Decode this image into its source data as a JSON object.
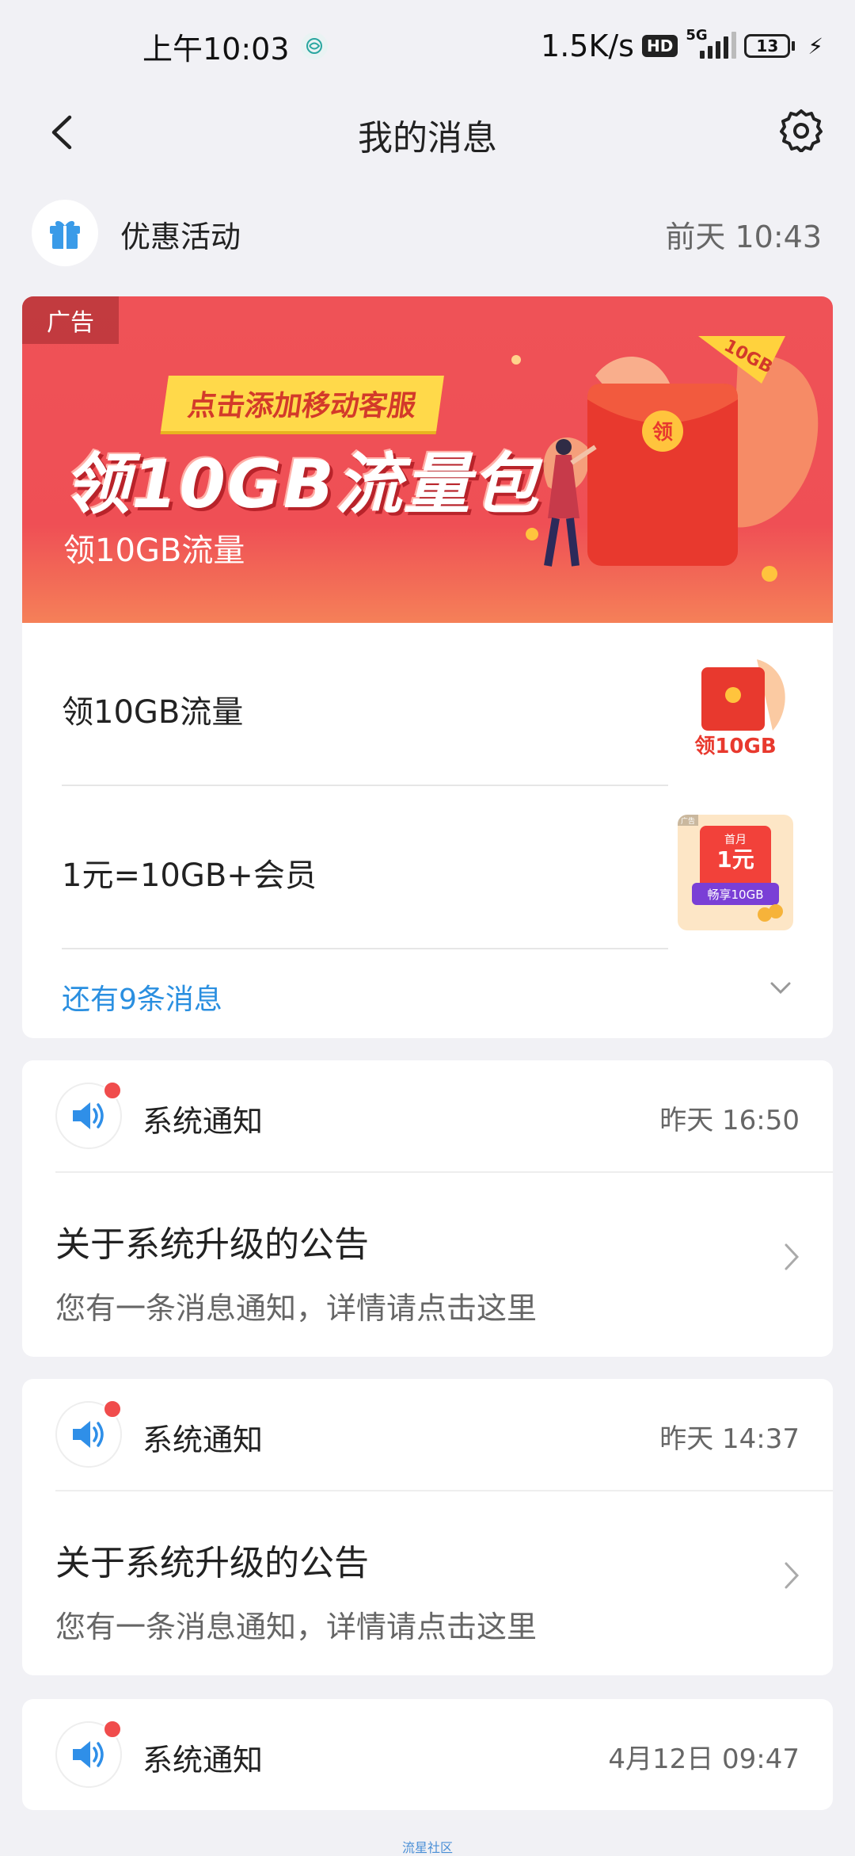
{
  "status_bar": {
    "time": "上午10:03",
    "speed": "1.5K/s",
    "hd": "HD",
    "network": "5G",
    "battery": "13"
  },
  "nav": {
    "title": "我的消息"
  },
  "promo": {
    "label": "优惠活动",
    "time": "前天 10:43",
    "banner": {
      "ad_tag": "广告",
      "ribbon": "点击添加移动客服",
      "headline": "领10GB流量包",
      "subtitle": "领10GB流量",
      "red_packet_char": "领",
      "corner_tag": "10GB"
    },
    "items": [
      {
        "text": "领10GB流量",
        "thumb_label": "领10GB"
      },
      {
        "text": "1元=10GB+会员",
        "thumb_top": "首月",
        "thumb_price": "1元",
        "thumb_bottom": "畅享10GB",
        "thumb_tag": "广告"
      }
    ],
    "more": "还有9条消息"
  },
  "notifications": [
    {
      "title": "系统通知",
      "time": "昨天 16:50",
      "heading": "关于系统升级的公告",
      "desc": "您有一条消息通知，详情请点击这里"
    },
    {
      "title": "系统通知",
      "time": "昨天 14:37",
      "heading": "关于系统升级的公告",
      "desc": "您有一条消息通知，详情请点击这里"
    },
    {
      "title": "系统通知",
      "time": "4月12日 09:47"
    }
  ],
  "footer": {
    "watermark": "流星社区"
  },
  "colors": {
    "accent": "#2a8fe0",
    "banner_red": "#ef5257",
    "badge_red": "#f04c4c",
    "background": "#f1f1f5"
  }
}
